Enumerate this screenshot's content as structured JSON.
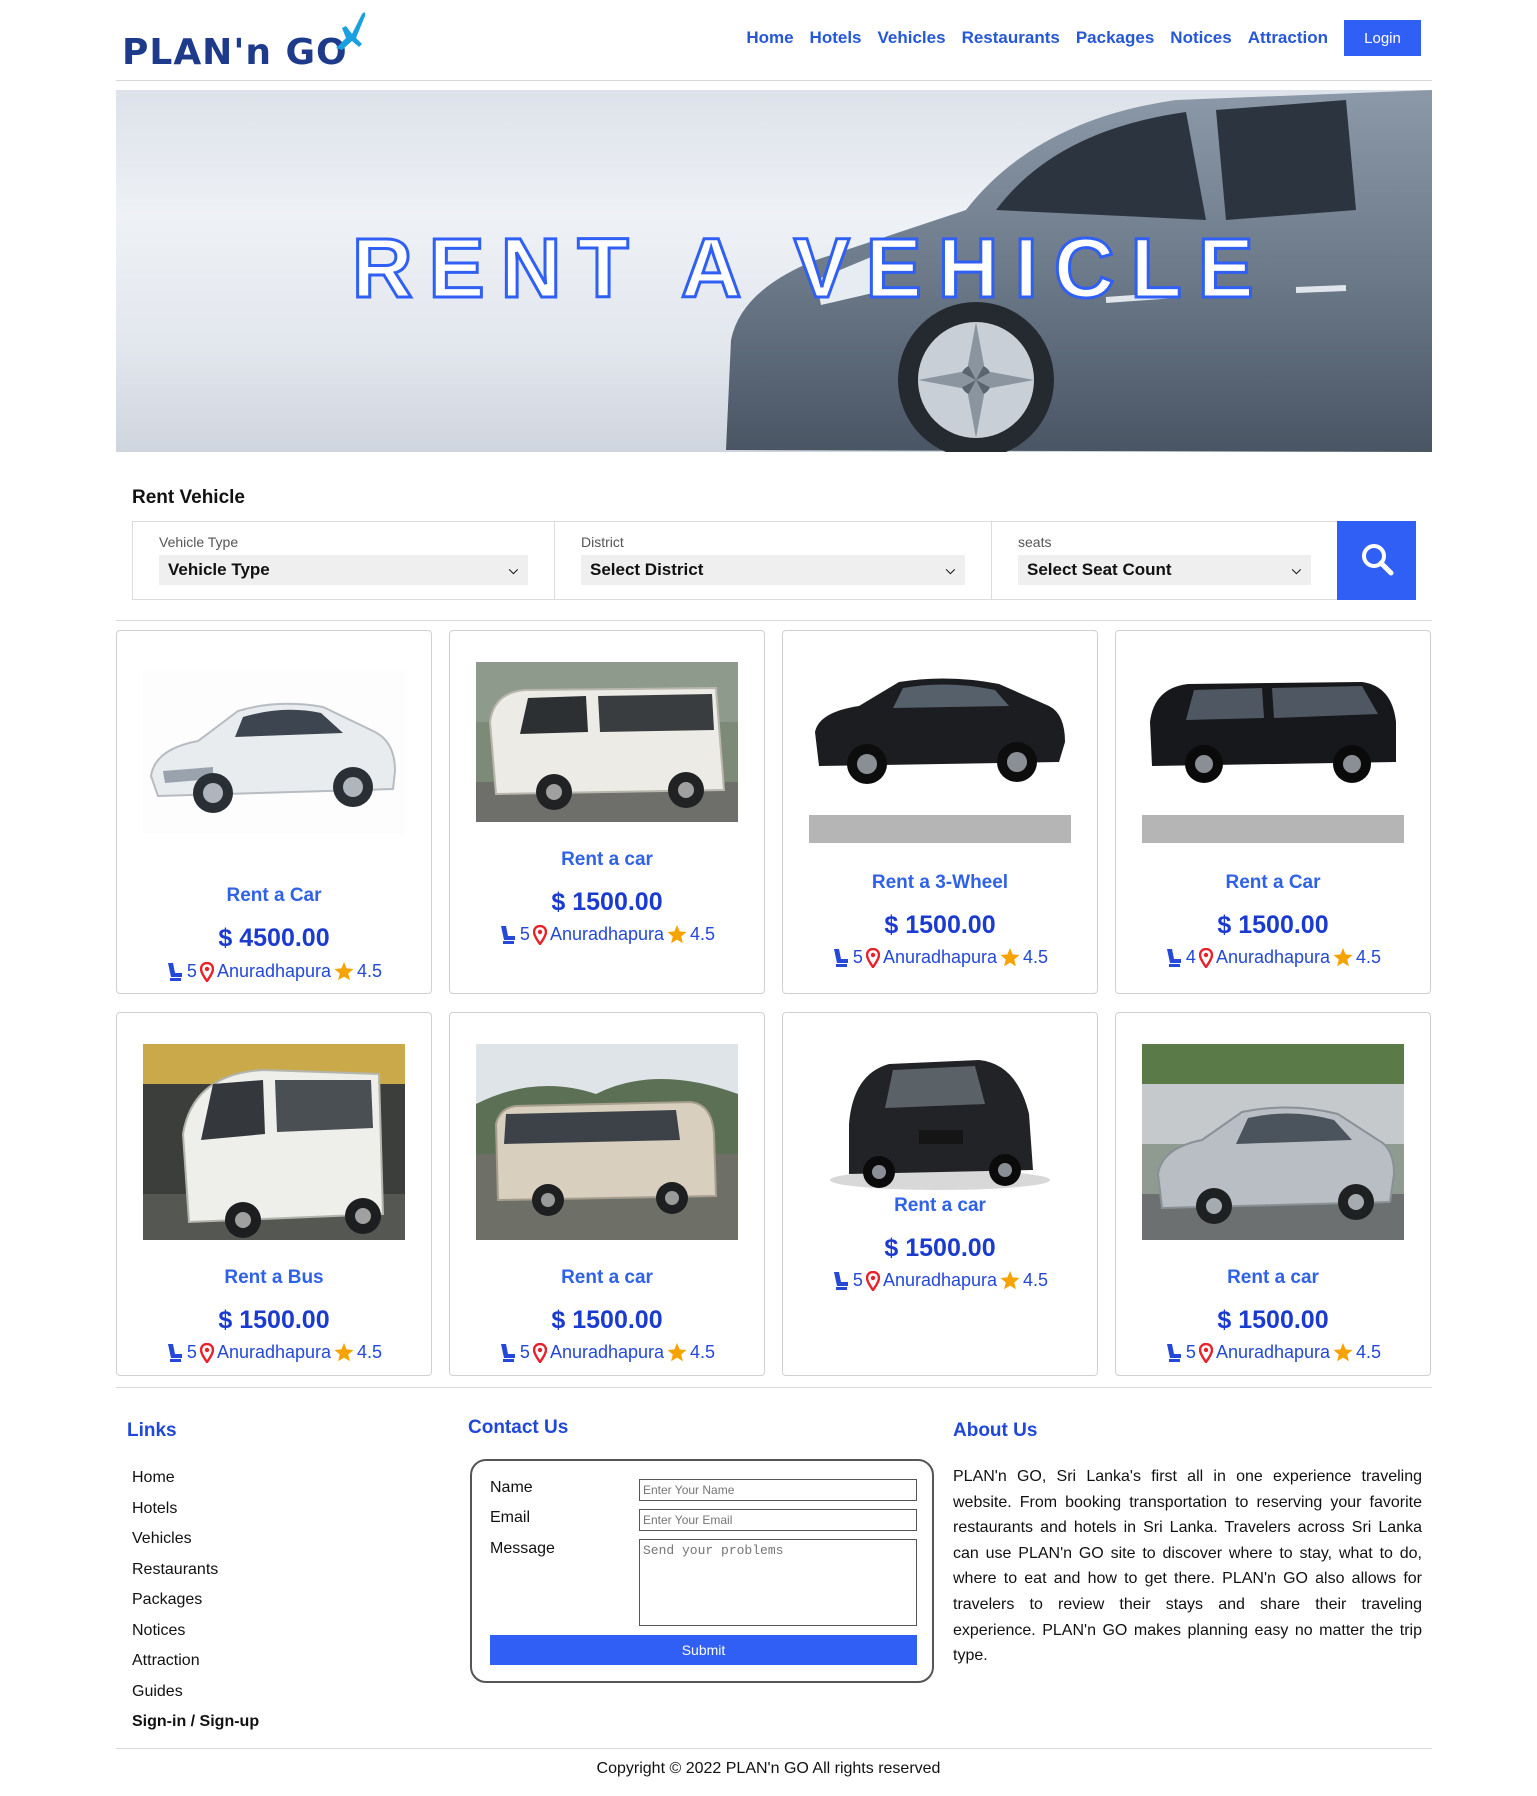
{
  "header": {
    "logo_text": "PLAN'n GO",
    "nav": [
      "Home",
      "Hotels",
      "Vehicles",
      "Restaurants",
      "Packages",
      "Notices",
      "Attraction"
    ],
    "login_label": "Login"
  },
  "hero": {
    "title": "RENT A VEHICLE"
  },
  "search": {
    "heading": "Rent Vehicle",
    "fields": [
      {
        "label": "Vehicle Type",
        "value": "Vehicle Type"
      },
      {
        "label": "District",
        "value": "Select District"
      },
      {
        "label": "seats",
        "value": "Select Seat Count"
      }
    ]
  },
  "vehicles": [
    {
      "title": "Rent a Car",
      "price": "$ 4500.00",
      "seats": "5",
      "location": "Anuradhapura",
      "rating": "4.5",
      "icon": "white-hybrid-car"
    },
    {
      "title": "Rent a car",
      "price": "$ 1500.00",
      "seats": "5",
      "location": "Anuradhapura",
      "rating": "4.5",
      "icon": "white-van"
    },
    {
      "title": "Rent a 3-Wheel",
      "price": "$ 1500.00",
      "seats": "5",
      "location": "Anuradhapura",
      "rating": "4.5",
      "icon": "black-sedan"
    },
    {
      "title": "Rent a Car",
      "price": "$ 1500.00",
      "seats": "4",
      "location": "Anuradhapura",
      "rating": "4.5",
      "icon": "black-minivan"
    },
    {
      "title": "Rent a Bus",
      "price": "$ 1500.00",
      "seats": "5",
      "location": "Anuradhapura",
      "rating": "4.5",
      "icon": "white-mini-van"
    },
    {
      "title": "Rent a car",
      "price": "$ 1500.00",
      "seats": "5",
      "location": "Anuradhapura",
      "rating": "4.5",
      "icon": "coach-bus"
    },
    {
      "title": "Rent a car",
      "price": "$ 1500.00",
      "seats": "5",
      "location": "Anuradhapura",
      "rating": "4.5",
      "icon": "black-hatchback"
    },
    {
      "title": "Rent a car",
      "price": "$ 1500.00",
      "seats": "5",
      "location": "Anuradhapura",
      "rating": "4.5",
      "icon": "silver-sedan"
    }
  ],
  "footer": {
    "links_heading": "Links",
    "links": [
      "Home",
      "Hotels",
      "Vehicles",
      "Restaurants",
      "Packages",
      "Notices",
      "Attraction",
      "Guides",
      "Sign-in / Sign-up"
    ],
    "contact_heading": "Contact Us",
    "contact": {
      "name_label": "Name",
      "name_placeholder": "Enter Your Name",
      "email_label": "Email",
      "email_placeholder": "Enter Your Email",
      "message_label": "Message",
      "message_placeholder": "Send your problems",
      "submit_label": "Submit"
    },
    "about_heading": "About Us",
    "about_text": "PLAN'n GO, Sri Lanka's first all in one experience traveling website. From booking transportation to reserving your favorite restaurants and hotels in Sri Lanka. Travelers across Sri Lanka can use PLAN'n GO site to discover where to stay, what to do, where to eat and how to get there. PLAN'n GO also allows for travelers to review their stays and share their traveling experience. PLAN'n GO makes planning easy no matter the trip type.",
    "copyright": "Copyright © 2022 PLAN'n GO All rights reserved"
  },
  "colors": {
    "accent": "#2f5ff5",
    "link": "#2557d6",
    "price": "#1b3bd0",
    "pin": "#e8212b",
    "star": "#f5a300"
  }
}
